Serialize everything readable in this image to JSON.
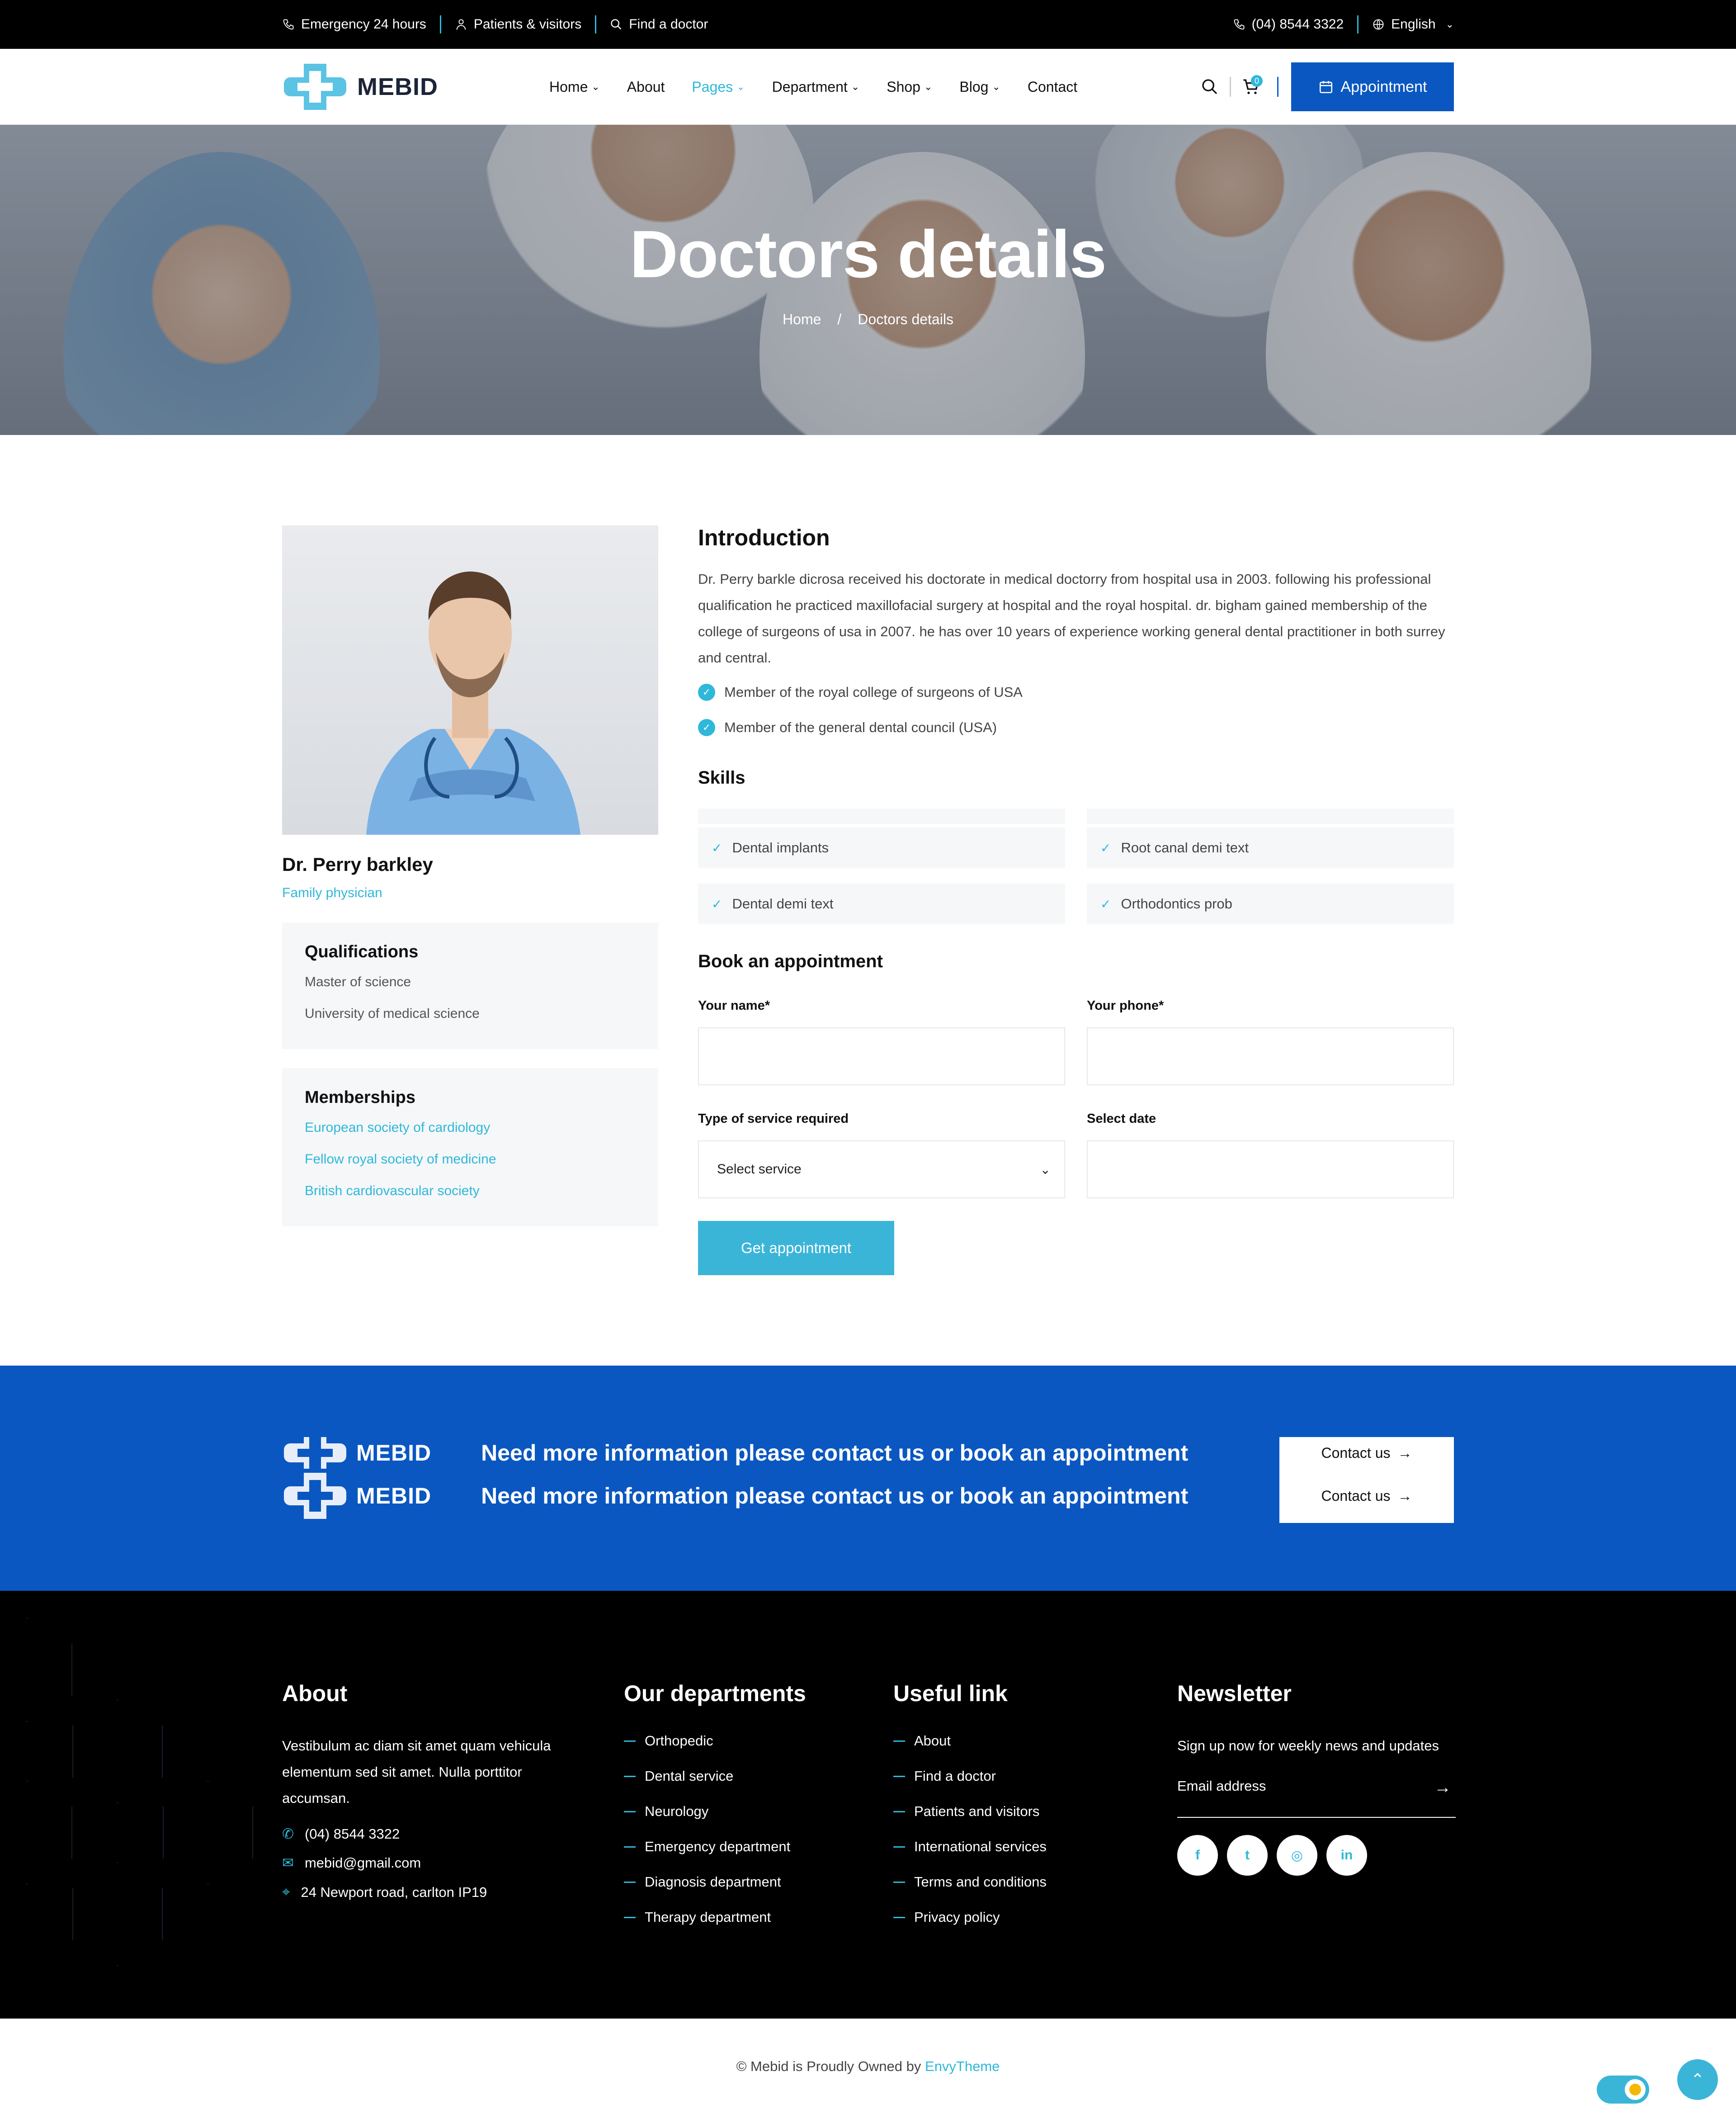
{
  "topbar": {
    "emergency": "Emergency 24 hours",
    "patients": "Patients & visitors",
    "find_doctor": "Find a doctor",
    "phone": "(04) 8544 3322",
    "language": "English"
  },
  "nav": {
    "logo_text": "MEBID",
    "menu": [
      {
        "label": "Home",
        "dropdown": true
      },
      {
        "label": "About",
        "dropdown": false
      },
      {
        "label": "Pages",
        "dropdown": true,
        "active": true
      },
      {
        "label": "Department",
        "dropdown": true
      },
      {
        "label": "Shop",
        "dropdown": true
      },
      {
        "label": "Blog",
        "dropdown": true
      },
      {
        "label": "Contact",
        "dropdown": false
      }
    ],
    "cart_count": "0",
    "appointment_label": "Appointment"
  },
  "hero": {
    "title": "Doctors details",
    "breadcrumb_home": "Home",
    "breadcrumb_sep": "/",
    "breadcrumb_current": "Doctors details"
  },
  "doctor": {
    "name": "Dr. Perry barkley",
    "role": "Family physician",
    "qualifications": {
      "title": "Qualifications",
      "items": [
        "Master of science",
        "University of medical science"
      ]
    },
    "memberships": {
      "title": "Memberships",
      "items": [
        "European society of cardiology",
        "Fellow royal society of medicine",
        "British cardiovascular society"
      ]
    }
  },
  "intro": {
    "title": "Introduction",
    "text": "Dr. Perry barkle dicrosa received his doctorate in medical doctorry from hospital usa in 2003. following his professional qualification he practiced maxillofacial surgery at hospital and the royal hospital. dr. bigham gained membership of the college of surgeons of usa in 2007. he has over 10 years of experience working general dental practitioner in both surrey and central.",
    "checks": [
      "Member of the royal college of surgeons of USA",
      "Member of the general dental council (USA)"
    ]
  },
  "skills": {
    "title": "Skills",
    "items": [
      "Dental implants",
      "Root canal demi text",
      "Dental demi text",
      "Orthodontics prob"
    ]
  },
  "booking": {
    "title": "Book an appointment",
    "name_label": "Your name*",
    "phone_label": "Your phone*",
    "service_label": "Type of service required",
    "service_value": "Select service",
    "date_label": "Select date",
    "submit_label": "Get appointment"
  },
  "cta": {
    "logo_text": "MEBID",
    "text": "Need more information please contact us or book an appointment",
    "button_label": "Contact us"
  },
  "footer": {
    "about": {
      "title": "About",
      "text": "Vestibulum ac diam sit amet quam vehicula elementum sed sit amet. Nulla porttitor accumsan.",
      "phone": "(04) 8544 3322",
      "email": "mebid@gmail.com",
      "address": "24 Newport road, carlton IP19"
    },
    "departments": {
      "title": "Our departments",
      "items": [
        "Orthopedic",
        "Dental service",
        "Neurology",
        "Emergency department",
        "Diagnosis department",
        "Therapy department"
      ]
    },
    "useful": {
      "title": "Useful link",
      "items": [
        "About",
        "Find a doctor",
        "Patients and visitors",
        "International services",
        "Terms and conditions",
        "Privacy policy"
      ]
    },
    "newsletter": {
      "title": "Newsletter",
      "text": "Sign up now for weekly news and updates",
      "placeholder": "Email address",
      "socials": [
        "facebook-icon",
        "twitter-icon",
        "instagram-icon",
        "linkedin-icon"
      ]
    }
  },
  "copyright": {
    "text": "© Mebid is Proudly Owned by",
    "brand": "EnvyTheme"
  },
  "colors": {
    "accent": "#2fb8d9",
    "primary_blue": "#0a57c1",
    "dark": "#000000"
  }
}
